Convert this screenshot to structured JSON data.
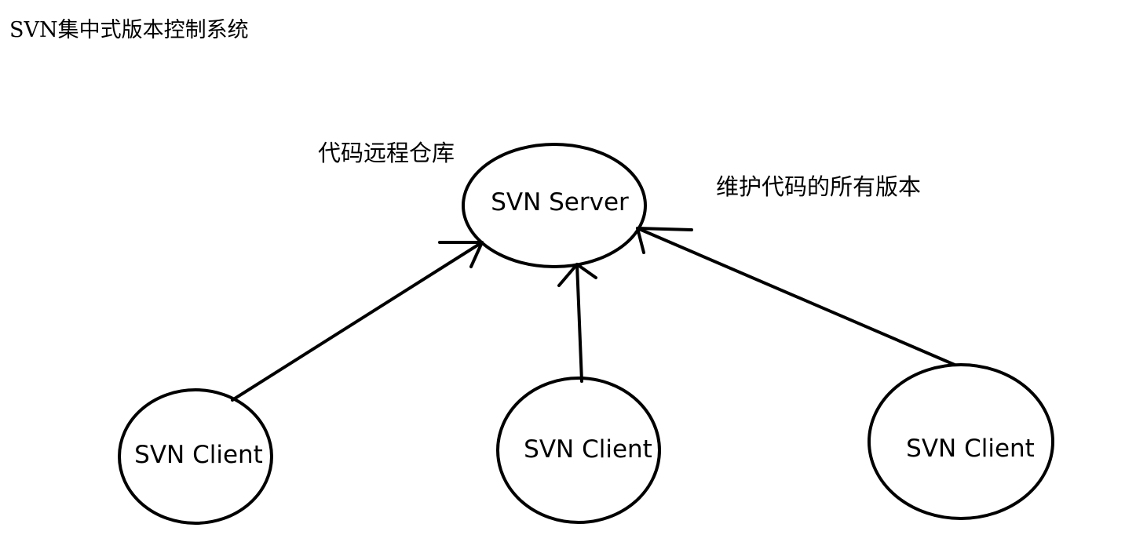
{
  "title": "SVN集中式版本控制系统",
  "server": {
    "label": "SVN Server",
    "note_left": "代码远程仓库",
    "note_right": "维护代码的所有版本"
  },
  "clients": [
    {
      "label": "SVN Client"
    },
    {
      "label": "SVN Client"
    },
    {
      "label": "SVN Client"
    }
  ],
  "colors": {
    "stroke": "#000000",
    "background": "#ffffff"
  }
}
